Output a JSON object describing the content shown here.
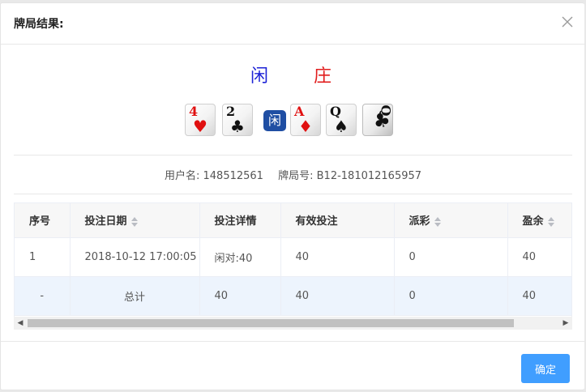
{
  "dialog": {
    "title": "牌局结果:",
    "player_label": "闲",
    "banker_label": "庄",
    "player_badge": "闲",
    "confirm_label": "确定"
  },
  "cards": [
    {
      "rank": "4",
      "suit": "♥",
      "color": "red"
    },
    {
      "rank": "2",
      "suit": "♣",
      "color": "black"
    },
    {
      "rank": "A",
      "suit": "♦",
      "color": "red"
    },
    {
      "rank": "Q",
      "suit": "♠",
      "color": "black"
    },
    {
      "rank": "Q",
      "suit": "♣",
      "color": "black",
      "rotated": true
    }
  ],
  "info": {
    "username_label": "用户名:",
    "username": "148512561",
    "round_label": "牌局号:",
    "round_id": "B12-181012165957"
  },
  "table": {
    "headers": [
      "序号",
      "投注日期",
      "投注详情",
      "有效投注",
      "派彩",
      "盈余"
    ],
    "rows": [
      [
        "1",
        "2018-10-12 17:00:05",
        "闲对:40",
        "40",
        "0",
        "40"
      ]
    ],
    "total": [
      "-",
      "总计",
      "40",
      "40",
      "0",
      "40"
    ]
  },
  "colors": {
    "player": "#1d22d6",
    "banker": "#e11d1d",
    "primary": "#409eff"
  }
}
